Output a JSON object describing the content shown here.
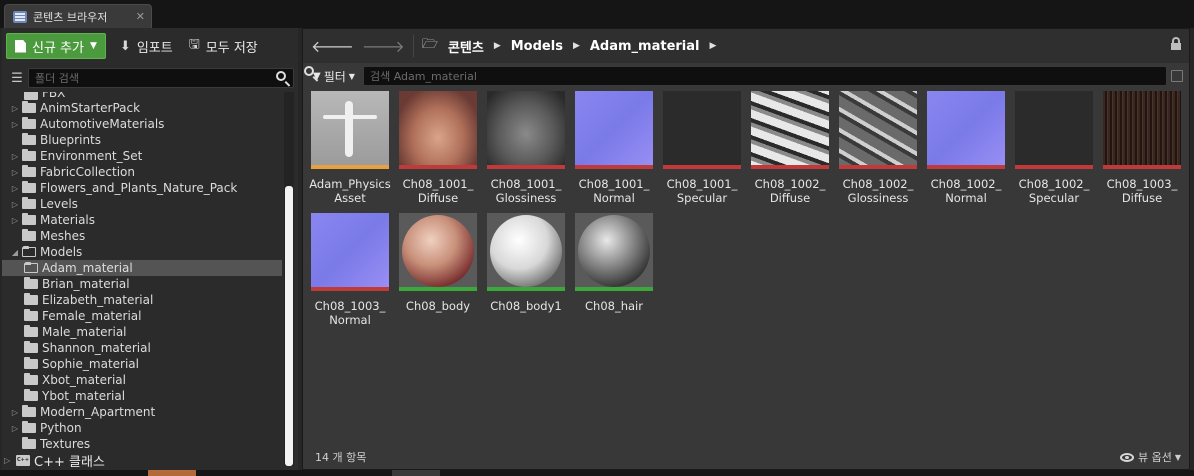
{
  "tab": {
    "title": "콘텐츠 브라우저",
    "close": "✕"
  },
  "toolbar": {
    "new_label": "신규 추가",
    "import_label": "임포트",
    "save_all_label": "모두 저장"
  },
  "folder_search": {
    "placeholder": "폴더 검색"
  },
  "tree": {
    "partial_top": "FBX",
    "items": [
      {
        "label": "AnimStarterPack",
        "arrow": "▷"
      },
      {
        "label": "AutomotiveMaterials",
        "arrow": "▷"
      },
      {
        "label": "Blueprints",
        "arrow": ""
      },
      {
        "label": "Environment_Set",
        "arrow": "▷"
      },
      {
        "label": "FabricCollection",
        "arrow": "▷"
      },
      {
        "label": "Flowers_and_Plants_Nature_Pack",
        "arrow": "▷"
      },
      {
        "label": "Levels",
        "arrow": "▷"
      },
      {
        "label": "Materials",
        "arrow": "▷"
      },
      {
        "label": "Meshes",
        "arrow": ""
      },
      {
        "label": "Models",
        "arrow": "◢"
      }
    ],
    "model_children": [
      "Adam_material",
      "Brian_material",
      "Elizabeth_material",
      "Female_material",
      "Male_material",
      "Shannon_material",
      "Sophie_material",
      "Xbot_material",
      "Ybot_material"
    ],
    "after_items": [
      {
        "label": "Modern_Apartment",
        "arrow": "▷"
      },
      {
        "label": "Python",
        "arrow": "▷"
      },
      {
        "label": "Textures",
        "arrow": ""
      }
    ],
    "cpp_label": "C++ 클래스",
    "cpp_icon_text": "C++"
  },
  "path": {
    "crumbs": [
      "콘텐츠",
      "Models",
      "Adam_material"
    ]
  },
  "filter": {
    "label": "필터",
    "search_placeholder": "검색 Adam_material"
  },
  "assets": [
    {
      "name": "Adam_Physics Asset",
      "strip": "#e8a040",
      "kind": "physics"
    },
    {
      "name": "Ch08_1001_ Diffuse",
      "strip": "#c03a3a",
      "kind": "face"
    },
    {
      "name": "Ch08_1001_ Glossiness",
      "strip": "#c03a3a",
      "kind": "gray-face"
    },
    {
      "name": "Ch08_1001_ Normal",
      "strip": "#c03a3a",
      "kind": "normal"
    },
    {
      "name": "Ch08_1001_ Specular",
      "strip": "#c03a3a",
      "kind": "dark"
    },
    {
      "name": "Ch08_1002_ Diffuse",
      "strip": "#c03a3a",
      "kind": "bw"
    },
    {
      "name": "Ch08_1002_ Glossiness",
      "strip": "#c03a3a",
      "kind": "bw2"
    },
    {
      "name": "Ch08_1002_ Normal",
      "strip": "#c03a3a",
      "kind": "normal"
    },
    {
      "name": "Ch08_1002_ Specular",
      "strip": "#c03a3a",
      "kind": "dark"
    },
    {
      "name": "Ch08_1003_ Diffuse",
      "strip": "#c03a3a",
      "kind": "hair"
    },
    {
      "name": "Ch08_1003_ Normal",
      "strip": "#c03a3a",
      "kind": "normal"
    },
    {
      "name": "Ch08_body",
      "strip": "#3aa83a",
      "kind": "sphere-body"
    },
    {
      "name": "Ch08_body1",
      "strip": "#3aa83a",
      "kind": "sphere-white"
    },
    {
      "name": "Ch08_hair",
      "strip": "#3aa83a",
      "kind": "sphere-hair"
    }
  ],
  "footer": {
    "count": "14 개 항목",
    "view_options": "뷰 옵션"
  }
}
